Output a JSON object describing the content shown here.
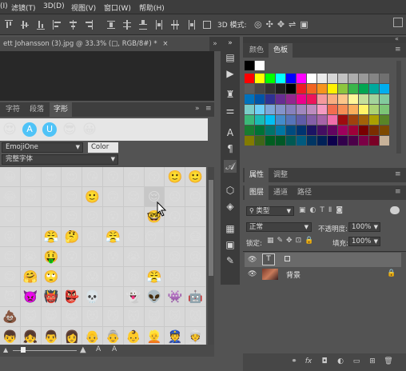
{
  "menubar": {
    "items": [
      "(I)",
      "滤镜(T)",
      "3D(D)",
      "视图(V)",
      "窗口(W)",
      "帮助(H)"
    ],
    "mode3d_label": "3D 模式:"
  },
  "document": {
    "tab_title": "ett Johansson (3).jpg @ 33.3% (□, RGB/8#) *",
    "close_symbol": "×"
  },
  "glyphs": {
    "tabs": [
      "字符",
      "段落",
      "字形"
    ],
    "active_tab": "字形",
    "recent": [
      "😍",
      "A",
      "U",
      "😎",
      "😀"
    ],
    "font_family": "EmojiOne",
    "font_style": "完整字体",
    "color_label": "Color",
    "grid": [
      [
        "😀",
        "😁",
        "😎",
        "😍",
        "😘",
        "😗",
        "😙",
        "😚",
        "🙂",
        "🙂"
      ],
      [
        "😂",
        "😇",
        "😉",
        "😊",
        "🙂",
        "🙃",
        "😌",
        "😌",
        "😣",
        "😐"
      ],
      [
        "😏",
        "😑",
        "😶",
        "😒",
        "😕",
        "😮",
        "😯",
        "🤓",
        "😲",
        "😥"
      ],
      [
        "😜",
        "😩",
        "😤",
        "🤔",
        "😩",
        "😤",
        "😔",
        "😴",
        "😳",
        "😷"
      ],
      [
        "😊",
        "😭",
        "🤑",
        "😮",
        "😫",
        "😰",
        "😭",
        "😖",
        "😪",
        "😢"
      ],
      [
        "😋",
        "🤗",
        "🙄",
        "😨",
        "😱",
        "😵",
        "😫",
        "😤",
        "😞",
        "😡"
      ],
      [
        "😈",
        "👿",
        "👹",
        "👺",
        "💀",
        "☠",
        "👻",
        "👽",
        "👾",
        "🤖"
      ],
      [
        "💩",
        "😺",
        "😸",
        "😹",
        "😻",
        "😼",
        "😽",
        "🙀",
        "😿",
        "😾"
      ],
      [
        "👦",
        "👧",
        "👨",
        "👩",
        "👴",
        "👵",
        "👶",
        "👱",
        "👮",
        "👳"
      ]
    ],
    "highlight_row": 1,
    "highlight_col": 7
  },
  "colorpanel": {
    "tabs": [
      "颜色",
      "色板"
    ],
    "active_tab": "色板"
  },
  "properties": {
    "tabs": [
      "属性",
      "调整"
    ]
  },
  "layers": {
    "tabs": [
      "图层",
      "通道",
      "路径"
    ],
    "active_tab": "图层",
    "filter_kind": "类型",
    "blend_mode": "正常",
    "opacity_label": "不透明度:",
    "opacity_value": "100%",
    "lock_label": "锁定:",
    "fill_label": "填充:",
    "fill_value": "100%",
    "list": [
      {
        "name": "",
        "kind": "text"
      },
      {
        "name": "背景",
        "kind": "image"
      }
    ],
    "footer_icons": [
      "link-icon",
      "fx-icon",
      "mask-icon",
      "adjustment-icon",
      "group-icon",
      "new-layer-icon",
      "trash-icon"
    ],
    "footer_fx": "fx"
  },
  "swatches": {
    "top": [
      "#000000",
      "#ffffff"
    ],
    "rows": [
      [
        "#ff0000",
        "#ffff00",
        "#00ff00",
        "#00ffff",
        "#0000ff",
        "#ff00ff",
        "#ffffff",
        "#ebebeb",
        "#d6d6d6",
        "#c2c2c2",
        "#adadad",
        "#999999",
        "#858585",
        "#707070"
      ],
      [
        "#5c5c5c",
        "#474747",
        "#333333",
        "#1f1f1f",
        "#000000",
        "#ed1c24",
        "#f26522",
        "#f7941d",
        "#fff200",
        "#8dc63f",
        "#39b54a",
        "#00a651",
        "#00a99d",
        "#00aeef"
      ],
      [
        "#0072bc",
        "#0054a6",
        "#2e3192",
        "#662d91",
        "#92278f",
        "#ec008c",
        "#ed145b",
        "#f5989d",
        "#f9ad81",
        "#fdc68a",
        "#fff799",
        "#c4df9b",
        "#a3d39c",
        "#82ca9d"
      ],
      [
        "#7bcdc8",
        "#6dcff6",
        "#7da7d9",
        "#8393ca",
        "#8781bd",
        "#a187be",
        "#bd8cbf",
        "#f49ac2",
        "#f26c4f",
        "#f68e56",
        "#fbaf5d",
        "#fff467",
        "#acd373",
        "#7cc576"
      ],
      [
        "#3bb878",
        "#1abbb4",
        "#00bff3",
        "#438ccb",
        "#5574b9",
        "#605ca8",
        "#855fa8",
        "#a763a8",
        "#f06eaa",
        "#9e0b0f",
        "#a0410d",
        "#a36209",
        "#aba000",
        "#598527"
      ],
      [
        "#197b30",
        "#007236",
        "#00746b",
        "#0076a3",
        "#004b80",
        "#003471",
        "#1b1464",
        "#440e62",
        "#630460",
        "#9e005d",
        "#9e0039",
        "#790000",
        "#7b2e00",
        "#7d4900"
      ],
      [
        "#827b00",
        "#406618",
        "#005e20",
        "#005826",
        "#005952",
        "#005b7f",
        "#003663",
        "#002157",
        "#0d004c",
        "#32004b",
        "#4b0049",
        "#7b0046",
        "#7a0026",
        "#c7b299"
      ]
    ]
  }
}
